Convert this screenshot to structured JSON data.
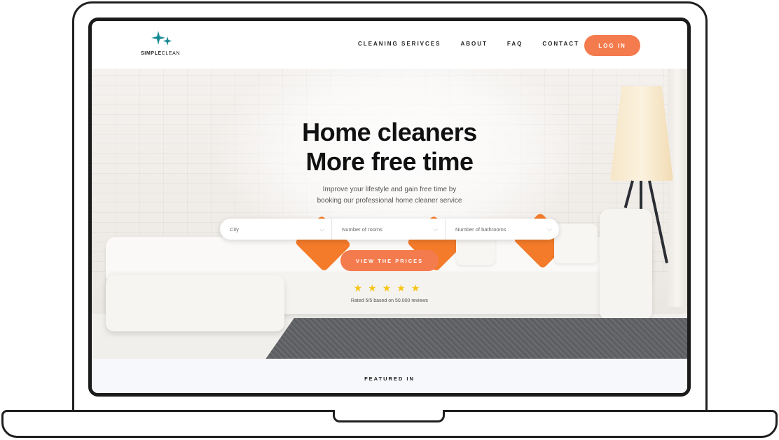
{
  "navbar": {
    "logo": {
      "word_bold": "SIMPLE",
      "word_light": "CLEAN"
    },
    "links": [
      "CLEANING SERIVCES",
      "ABOUT",
      "FAQ",
      "CONTACT"
    ],
    "login_label": "LOG IN"
  },
  "hero": {
    "title_line1": "Home cleaners",
    "title_line2": "More free time",
    "subtitle_line1": "Improve your lifestyle and gain free time by",
    "subtitle_line2": "booking our professional home cleaner service",
    "search": {
      "city_placeholder": "City",
      "rooms_placeholder": "Number of rooms",
      "bathrooms_placeholder": "Number of bathrooms"
    },
    "cta_label": "VIEW THE PRICES",
    "rating": {
      "stars": 5,
      "text": "Rated 5/5 based on 50.000 reviews"
    }
  },
  "featured": {
    "label": "FEATURED IN"
  },
  "colors": {
    "accent": "#f47b4e",
    "star": "#f5c518",
    "logo": "#1a8a96",
    "text_dark": "#111111"
  }
}
